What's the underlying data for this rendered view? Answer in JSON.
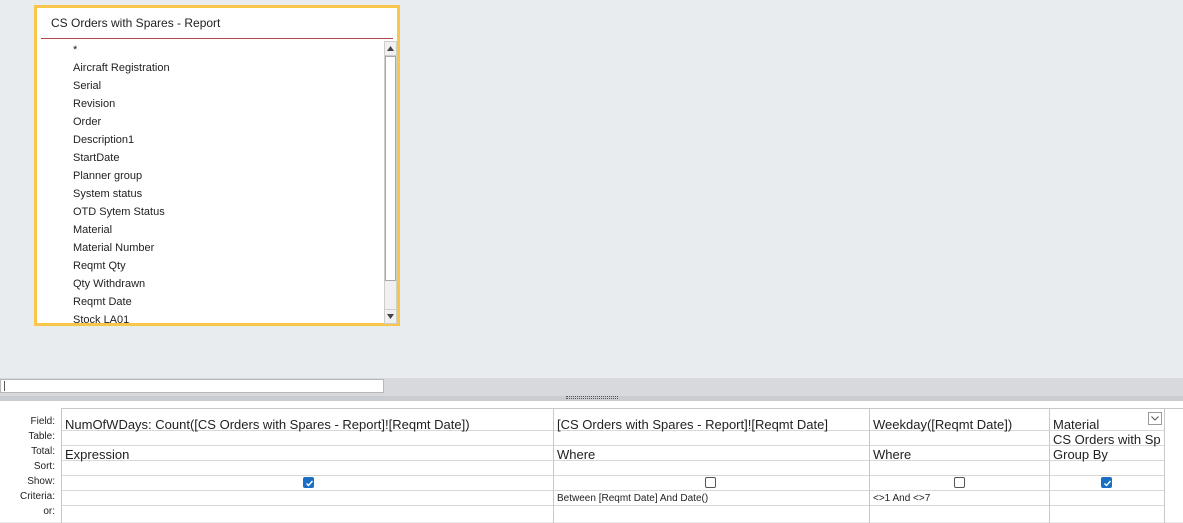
{
  "field_list": {
    "title": "CS Orders with Spares - Report",
    "fields": [
      "*",
      "Aircraft Registration",
      "Serial",
      "Revision",
      "Order",
      "Description1",
      "StartDate",
      "Planner group",
      "System status",
      "OTD Sytem Status",
      "Material",
      "Material Number",
      "Reqmt Qty",
      "Qty Withdrawn",
      "Reqmt Date",
      "Stock LA01"
    ]
  },
  "grid": {
    "row_labels": {
      "field": "Field:",
      "table": "Table:",
      "total": "Total:",
      "sort": "Sort:",
      "show": "Show:",
      "criteria": "Criteria:",
      "or": "or:"
    },
    "columns": [
      {
        "field": "NumOfWDays: Count([CS Orders with Spares - Report]![Reqmt Date])",
        "table": "",
        "total": "Expression",
        "sort": "",
        "show": true,
        "criteria": "",
        "or": ""
      },
      {
        "field": "[CS Orders with Spares - Report]![Reqmt Date]",
        "table": "",
        "total": "Where",
        "sort": "",
        "show": false,
        "criteria": "Between [Reqmt Date] And Date()",
        "or": ""
      },
      {
        "field": "Weekday([Reqmt Date])",
        "table": "",
        "total": "Where",
        "sort": "",
        "show": false,
        "criteria": "<>1 And <>7",
        "or": ""
      },
      {
        "field": "Material",
        "table": "CS Orders with Sp",
        "total": "Group By",
        "sort": "",
        "show": true,
        "criteria": "",
        "or": ""
      }
    ]
  },
  "icons": {
    "scroll_up": "scroll-up-arrow-icon",
    "scroll_down": "scroll-down-arrow-icon",
    "dropdown": "chevron-down-icon",
    "check": "checkmark-icon"
  },
  "colors": {
    "selected_outline": "#f7c64a",
    "checkbox_on": "#1a6fc4",
    "title_rule": "#b04a4a"
  }
}
